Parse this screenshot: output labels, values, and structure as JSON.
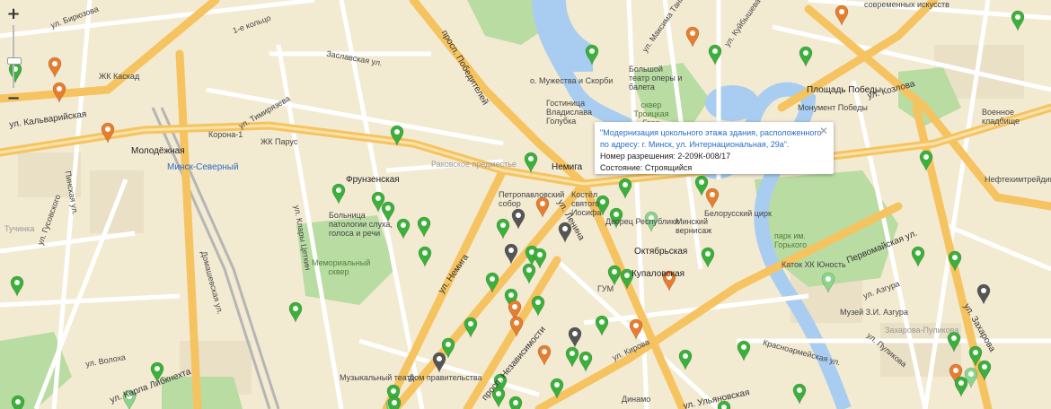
{
  "zoom": {
    "in_label": "+",
    "out_label": "−"
  },
  "popup": {
    "title": "\"Модернизация цокольного этажа здания, расположенного по адресу: г. Минск, ул. Интернациональная, 29а\".",
    "permit": "Номер разрешения: 2-209К-008/17",
    "status": "Состояние: Строящийся",
    "close": "✕"
  },
  "colors": {
    "marker_green": "#3bb03b",
    "marker_orange": "#e77e2f",
    "marker_gray": "#555555",
    "marker_lightgreen": "#8ad58a",
    "water": "#a9cdf0",
    "park": "#b9dca2",
    "road_main": "#f6c361",
    "road_minor": "#ffffff"
  },
  "labels": {
    "birjuzova": "ул. Бирюзова",
    "koltso1": "1-е кольцо",
    "kaskad": "ЖК Каскад",
    "kalvariyskaya": "ул. Кальварийская",
    "molodezhnaya": "Молодёжная",
    "minsk_severny": "Минск-Северный",
    "korona": "Корона-1",
    "parus": "ЖК Парус",
    "timiryazeva": "ул. Тимирязева",
    "zaslavskaya": "Заславская ул.",
    "frunzenskaya": "Фрунзенская",
    "hospital": "Больница патологии слуха, голоса и речи",
    "memorial_sq": "Мемориальный сквер",
    "klary": "ул. Клары Цеткин",
    "domashevskaya": "Домашевская ул.",
    "pobediteley": "просп. Победителей",
    "nemiga": "Немига",
    "nemiga_st": "ул. Немига",
    "lenina": "ул. Ленина",
    "petropavl": "Петропавловский собор",
    "gorkiy_park": "парк им. Горького",
    "ploshchad_pobedy": "Площадь Победы",
    "monument": "Монумент Победы",
    "teatr": "Большой театр оперы и балета",
    "troitskaya": "сквер Троицкая Гора",
    "oktyabrskaya": "Октябрьская",
    "kupalovskaya": "Купаловская",
    "cirk": "Белорусский цирк",
    "pervomayskaya": "Первомайская ул.",
    "kozlova": "ул. Козлова",
    "voennoe": "Военное кладбище",
    "neftekhim": "Нефтехимтрейдинг",
    "nezavisimosti": "просп. Независимости",
    "dom_pravitelstva": "Дом правительства",
    "muz_teatr": "Музыкальный театр",
    "dinamo": "Динамо",
    "ulyanovskaya": "ул. Ульяновская",
    "kirova": "ул. Кирова",
    "zakharova": "ул. Захарова",
    "krasnoarmeyskaya": "Красноармейская ул.",
    "muzey": "Музей З.И. Азгура",
    "zakharova_pulik": "Захарова-Пуликова",
    "volgi": "ул. Волоха",
    "libknekhta": "ул. Карла Либкнехта",
    "kuybysheva": "ул. Куйбышева",
    "maksima": "ул. Максима Танка",
    "tuchinka": "Тучинка",
    "gusovskogo": "ул. Гусовского",
    "pinskaya": "Пинская ул.",
    "mozhestvo": "о. Мужества и Скорби",
    "gostinitsa": "Гостиница Владислава Голубка",
    "katok": "Каток ХК Юность",
    "sovremennye": "современных искусств",
    "dvorets": "Дворец Республики",
    "minsk_vernisage": "Минский вернисаж",
    "kostel": "Костёл святого Иосифа",
    "gum": "ГУМ",
    "azgura": "ул. Азгура",
    "pulikova": "ул. Пуликова",
    "bogdanova": "Раковское предместье",
    "skver_label": "сквер"
  }
}
